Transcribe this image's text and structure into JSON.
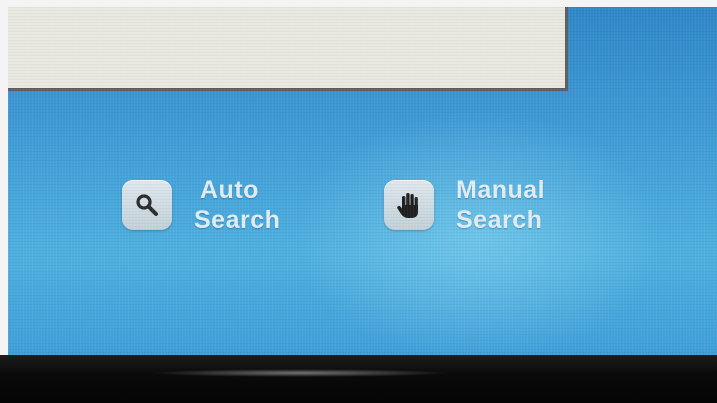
{
  "search_options": [
    {
      "id": "auto",
      "icon": "search-icon",
      "line1": "Auto",
      "line2": "Search"
    },
    {
      "id": "manual",
      "icon": "hand-icon",
      "line1": "Manual",
      "line2": "Search"
    }
  ],
  "colors": {
    "screen_background": "#3f9bd6",
    "panel_background": "#e9e9e2",
    "label_text": "#e3eef4",
    "icon_tile": "#cfdbe3",
    "bezel": "#0a0a0a"
  }
}
